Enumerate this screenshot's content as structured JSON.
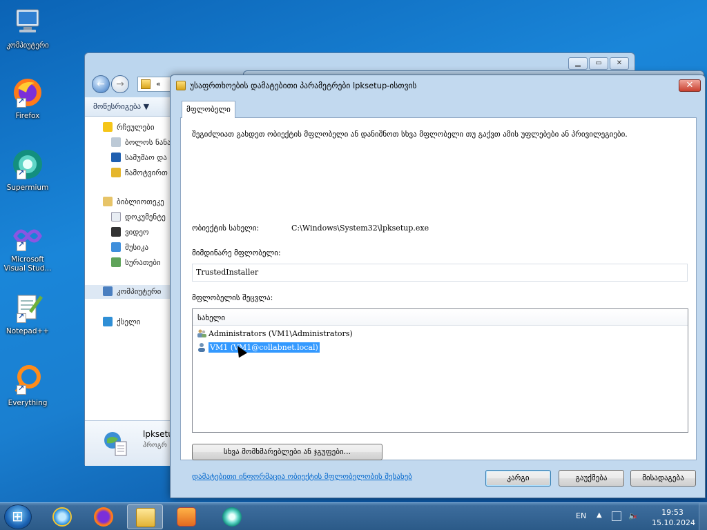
{
  "desktop": {
    "icons": [
      {
        "label": "კომპიუტერი",
        "icon": "computer-icon"
      },
      {
        "label": "Firefox",
        "icon": "firefox-icon"
      },
      {
        "label": "Supermium",
        "icon": "supermium-icon"
      },
      {
        "label": "Microsoft Visual Stud...",
        "icon": "visual-studio-icon"
      },
      {
        "label": "Notepad++",
        "icon": "notepadpp-icon"
      },
      {
        "label": "Everything",
        "icon": "everything-icon"
      }
    ]
  },
  "explorer": {
    "address_text": "«",
    "organize_label": "მოწესრიგება ▼",
    "nav_items": [
      {
        "label": "რჩეულები",
        "icon": "star-icon"
      },
      {
        "label": "ბოლოს ნანა",
        "icon": "recent-icon"
      },
      {
        "label": "სამუშაო და",
        "icon": "desktop-icon"
      },
      {
        "label": "ჩამოტვირთ",
        "icon": "downloads-icon"
      },
      {
        "label": "ბიბლიოთეკე",
        "icon": "libraries-icon"
      },
      {
        "label": "დოკუმენტე",
        "icon": "documents-icon"
      },
      {
        "label": "ვიდეო",
        "icon": "video-icon"
      },
      {
        "label": "მუსიკა",
        "icon": "music-icon"
      },
      {
        "label": "სურათები",
        "icon": "pictures-icon"
      },
      {
        "label": "კომპიუტერი",
        "icon": "computer-icon"
      },
      {
        "label": "ქსელი",
        "icon": "network-icon"
      }
    ],
    "details_name": "lpksetu",
    "details_type": "პროგრ"
  },
  "dialog": {
    "title": "უსაფრთხოების დამატებითი პარამეტრები lpksetup-ისთვის",
    "close_label": "✕",
    "tab_label": "მფლობელი",
    "intro": "შეგიძლიათ გახდეთ ობიექტის მფლობელი ან დანიშნოთ სხვა მფლობელი თუ გაქვთ ამის უფლებები ან პრივილეგიები.",
    "object_name_label": "ობიექტის სახელი:",
    "object_name_value": "C:\\Windows\\System32\\lpksetup.exe",
    "current_owner_label": "მიმდინარე მფლობელი:",
    "current_owner_value": "TrustedInstaller",
    "change_owner_label": "მფლობელის შეცვლა:",
    "list_header": "სახელი",
    "list_rows": [
      {
        "text": "Administrators (VM1\\Administrators)",
        "icon": "group-icon",
        "selected": false
      },
      {
        "text": "VM1 (VM1@collabnet.local)",
        "icon": "user-icon",
        "selected": true
      }
    ],
    "other_users_button": "სხვა მომხმარებლები ან ჯგუფები...",
    "info_link": "დამატებითი ინფორმაცია ობიექტის მფლობელობის შესახებ",
    "ok_button": "კარგი",
    "cancel_button": "გაუქმება",
    "apply_button": "მისადაგება"
  },
  "taskbar": {
    "language": "EN",
    "time": "19:53",
    "date": "15.10.2024",
    "apps": [
      "ie-icon",
      "firefox-icon",
      "explorer-icon",
      "media-player-icon",
      "supermium-icon"
    ]
  },
  "colors": {
    "selection": "#3399ff",
    "link": "#0066cc",
    "desktop_blue": "#1a86d9"
  }
}
